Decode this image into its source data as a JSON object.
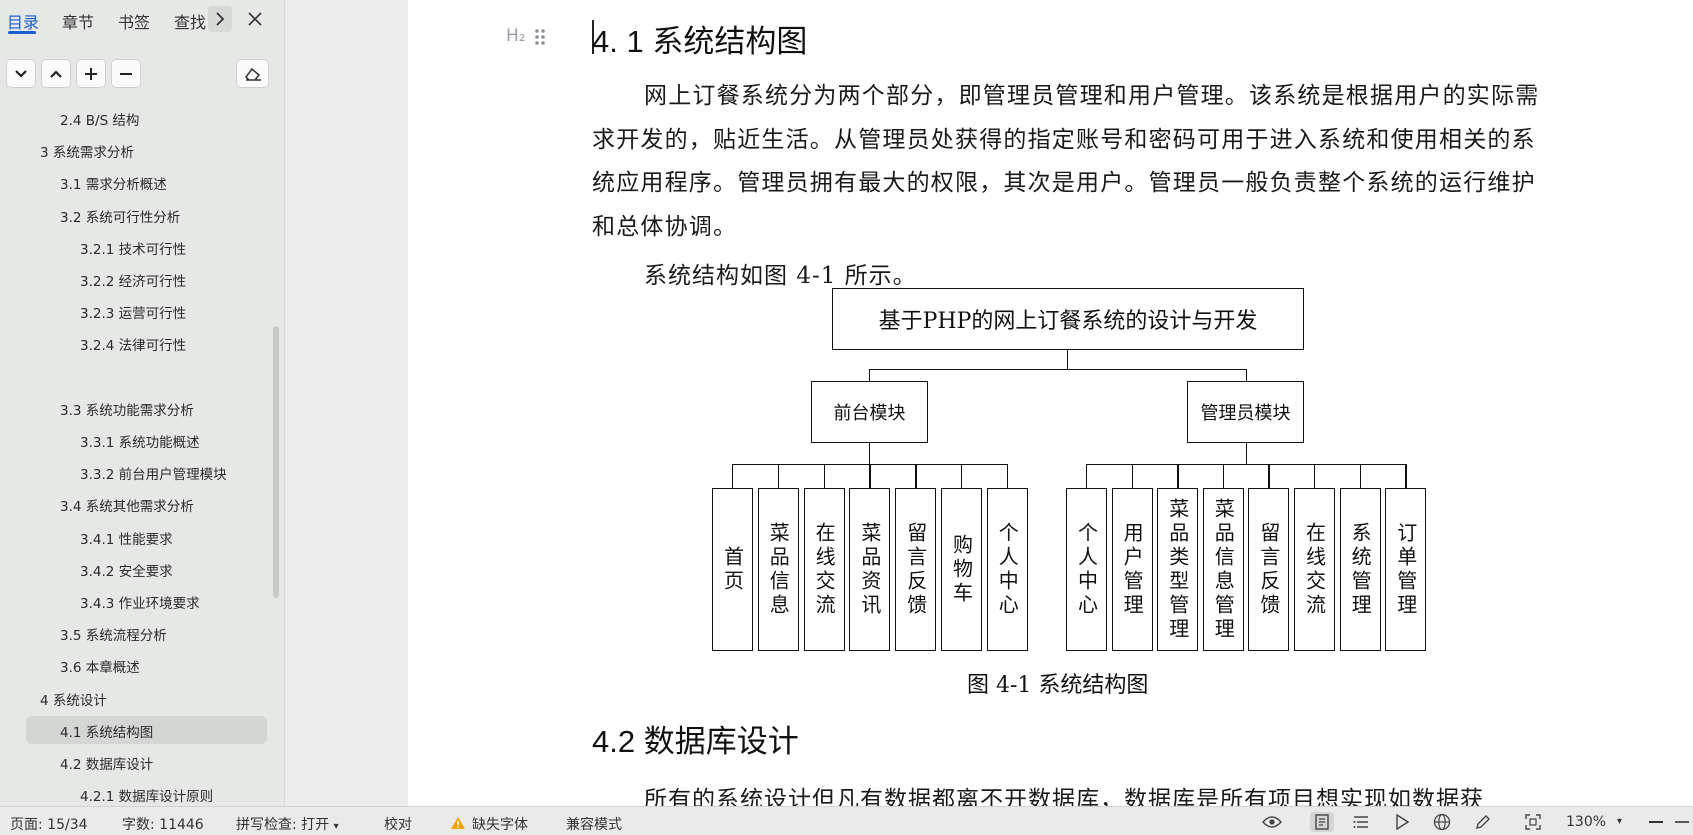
{
  "nav": {
    "tabs": [
      "目录",
      "章节",
      "书签",
      "查找"
    ],
    "more_icon": "chevron-right-icon",
    "close_icon": "close-icon",
    "tools": [
      {
        "name": "collapse-down-button",
        "icon": "chevron-down-icon"
      },
      {
        "name": "collapse-up-button",
        "icon": "chevron-up-icon"
      },
      {
        "name": "expand-all-button",
        "icon": "plus-icon"
      },
      {
        "name": "collapse-all-button",
        "icon": "minus-icon"
      },
      {
        "name": "toc-settings-button",
        "icon": "eraser-icon"
      }
    ],
    "toc": [
      {
        "label": "2.4 B/S 结构",
        "level": 2,
        "caret": false
      },
      {
        "label": "3 系统需求分析",
        "level": 1,
        "caret": true
      },
      {
        "label": "3.1 需求分析概述",
        "level": 2,
        "caret": false
      },
      {
        "label": "3.2 系统可行性分析",
        "level": 2,
        "caret": true
      },
      {
        "label": "3.2.1 技术可行性",
        "level": 3,
        "caret": false
      },
      {
        "label": "3.2.2 经济可行性",
        "level": 3,
        "caret": false
      },
      {
        "label": "3.2.3 运营可行性",
        "level": 3,
        "caret": false
      },
      {
        "label": "3.2.4 法律可行性",
        "level": 3,
        "caret": false
      },
      {
        "label": "",
        "level": 0,
        "caret": false
      },
      {
        "label": "3.3 系统功能需求分析",
        "level": 2,
        "caret": true
      },
      {
        "label": "3.3.1 系统功能概述",
        "level": 3,
        "caret": false
      },
      {
        "label": "3.3.2 前台用户管理模块",
        "level": 3,
        "caret": false
      },
      {
        "label": "3.4 系统其他需求分析",
        "level": 2,
        "caret": true
      },
      {
        "label": "3.4.1 性能要求",
        "level": 3,
        "caret": false
      },
      {
        "label": "3.4.2 安全要求",
        "level": 3,
        "caret": false
      },
      {
        "label": "3.4.3 作业环境要求",
        "level": 3,
        "caret": false
      },
      {
        "label": "3.5 系统流程分析",
        "level": 2,
        "caret": false
      },
      {
        "label": "3.6 本章概述",
        "level": 2,
        "caret": false
      },
      {
        "label": "4  系统设计",
        "level": 1,
        "caret": true
      },
      {
        "label": "4.1 系统结构图",
        "level": 2,
        "caret": false,
        "selected": true
      },
      {
        "label": "4.2 数据库设计",
        "level": 2,
        "caret": true
      },
      {
        "label": "4.2.1 数据库设计原则",
        "level": 3,
        "caret": false
      }
    ]
  },
  "doc": {
    "h2_marker": "H₂",
    "heading_1": "4. 1 系统结构图",
    "para_1": "网上订餐系统分为两个部分，即管理员管理和用户管理。该系统是根据用户的实际需求开发的，贴近生活。从管理员处获得的指定账号和密码可用于进入系统和使用相关的系统应用程序。管理员拥有最大的权限，其次是用户。管理员一般负责整个系统的运行维护和总体协调。",
    "para_2": "系统结构如图 4-1 所示。",
    "diagram": {
      "root": "基于PHP的网上订餐系统的设计与开发",
      "modules": [
        {
          "name": "前台模块",
          "children": [
            "首页",
            "菜品信息",
            "在线交流",
            "菜品资讯",
            "留言反馈",
            "购物车",
            "个人中心"
          ]
        },
        {
          "name": "管理员模块",
          "children": [
            "个人中心",
            "用户管理",
            "菜品类型管理",
            "菜品信息管理",
            "留言反馈",
            "在线交流",
            "系统管理",
            "订单管理"
          ]
        }
      ]
    },
    "caption": "图 4-1 系统结构图",
    "heading_2": "4.2 数据库设计",
    "para_3": "所有的系统设计但凡有数据都离不开数据库，数据库是所有项目想实现如数据获"
  },
  "status": {
    "page": "页面: 15/34",
    "words": "字数: 11446",
    "spellcheck": "拼写检查: 打开",
    "proofread": "校对",
    "missing_font": "缺失字体",
    "compat_mode": "兼容模式",
    "zoom": "130%"
  }
}
